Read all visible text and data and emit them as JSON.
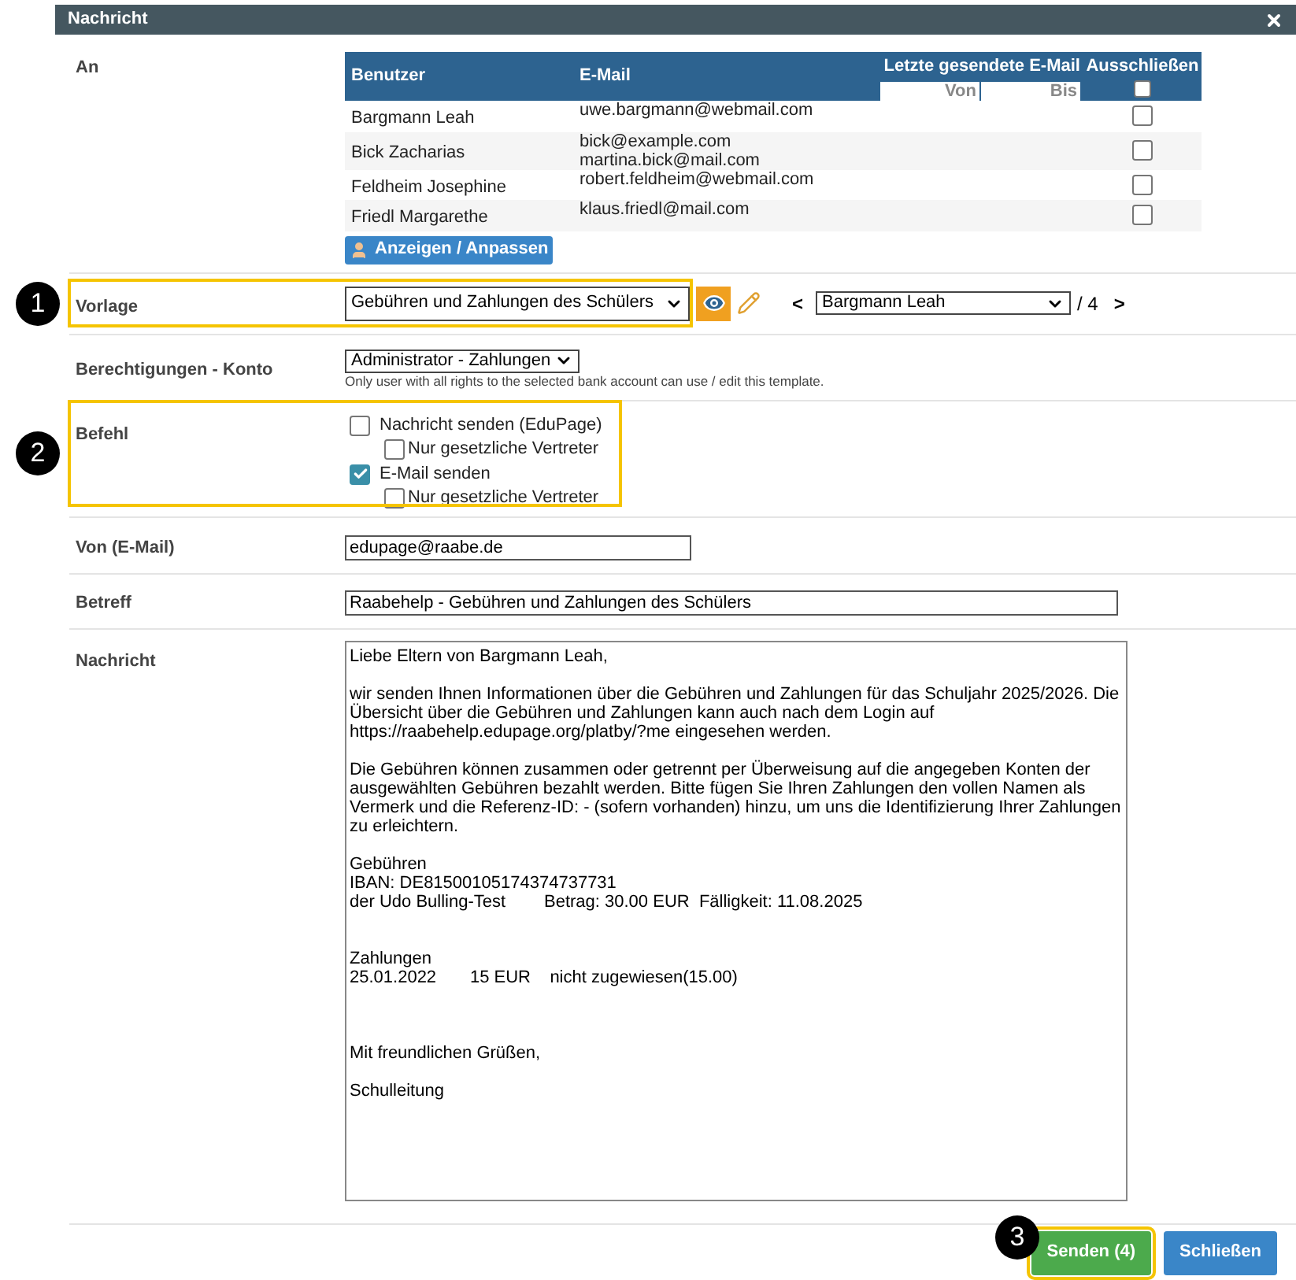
{
  "dialog": {
    "title": "Nachricht"
  },
  "recipients": {
    "label": "An",
    "columns": [
      "Benutzer",
      "E-Mail",
      "Letzte gesendete E-Mail",
      "Ausschließen"
    ],
    "from_placeholder": "Von",
    "to_placeholder": "Bis",
    "exclude_all_checked": false,
    "rows": [
      {
        "user": "Bargmann Leah",
        "emails": [
          "uwe.bargmann@webmail.com"
        ],
        "excluded": false
      },
      {
        "user": "Bick Zacharias",
        "emails": [
          "bick@example.com",
          "martina.bick@mail.com"
        ],
        "excluded": false
      },
      {
        "user": "Feldheim Josephine",
        "emails": [
          "robert.feldheim@webmail.com"
        ],
        "excluded": false
      },
      {
        "user": "Friedl Margarethe",
        "emails": [
          "klaus.friedl@mail.com"
        ],
        "excluded": false
      }
    ],
    "button": "Anzeigen / Anpassen"
  },
  "template": {
    "label": "Vorlage",
    "annotation": "1",
    "value": "Gebühren und Zahlungen des Schülers",
    "prev": "<",
    "student": "Bargmann Leah",
    "count": "/ 4",
    "next": ">"
  },
  "permissions": {
    "label": "Berechtigungen - Konto",
    "value": "Administrator - Zahlungen",
    "note": "Only user with all rights to the selected bank account can use / edit this template."
  },
  "command": {
    "label": "Befehl",
    "annotation": "2",
    "options": [
      {
        "label": "Nachricht senden (EduPage)",
        "checked": false,
        "sub": {
          "label": "Nur gesetzliche Vertreter",
          "checked": false
        }
      },
      {
        "label": "E-Mail senden",
        "checked": true,
        "sub": {
          "label": "Nur gesetzliche Vertreter",
          "checked": false
        }
      }
    ]
  },
  "from": {
    "label": "Von (E-Mail)",
    "value": "edupage@raabe.de"
  },
  "subject": {
    "label": "Betreff",
    "value": "Raabehelp - Gebühren und Zahlungen des Schülers"
  },
  "message": {
    "label": "Nachricht",
    "value": "Liebe Eltern von Bargmann Leah,\n\nwir senden Ihnen Informationen über die Gebühren und Zahlungen für das Schuljahr 2025/2026. Die Übersicht über die Gebühren und Zahlungen kann auch nach dem Login auf https://raabehelp.edupage.org/platby/?me eingesehen werden.\n\nDie Gebühren können zusammen oder getrennt per Überweisung auf die angegeben Konten der ausgewählten Gebühren bezahlt werden. Bitte fügen Sie Ihren Zahlungen den vollen Namen als Vermerk und die Referenz-ID: - (sofern vorhanden) hinzu, um uns die Identifizierung Ihrer Zahlungen zu erleichtern.\n\nGebühren\nIBAN: DE81500105174374737731\nder Udo Bulling-Test        Betrag: 30.00 EUR  Fälligkeit: 11.08.2025\n\n\nZahlungen\n25.01.2022       15 EUR    nicht zugewiesen(15.00)\n\n\n\nMit freundlichen Grüßen,\n\nSchulleitung"
  },
  "footer": {
    "annotation": "3",
    "buttons": [
      {
        "label": "Senden (4)",
        "kind": "send",
        "highlighted": true
      },
      {
        "label": "Schließen",
        "kind": "close",
        "highlighted": false
      }
    ]
  }
}
